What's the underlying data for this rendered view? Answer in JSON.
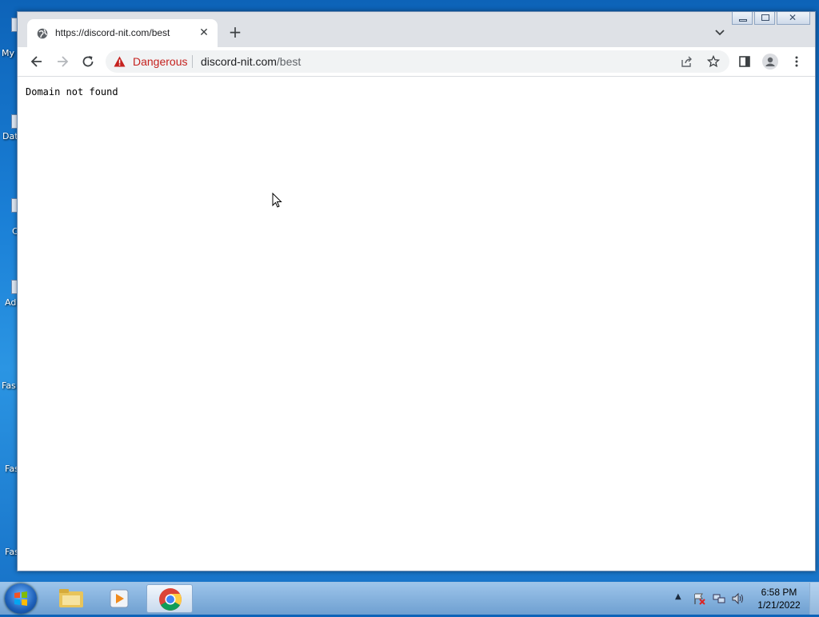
{
  "desktop": {
    "icons": [
      {
        "label": "My"
      },
      {
        "label": "Dat"
      },
      {
        "label": "C"
      },
      {
        "label": "Ad"
      },
      {
        "label": "Fas"
      },
      {
        "label": "Fas"
      },
      {
        "label": "Fas"
      }
    ]
  },
  "browser": {
    "tab": {
      "title": "https://discord-nit.com/best",
      "favicon": "globe-icon"
    },
    "omnibox": {
      "security_label": "Dangerous",
      "domain": "discord-nit.com",
      "path": "/best"
    },
    "page": {
      "text": "Domain not found"
    }
  },
  "taskbar": {
    "apps": [
      "windows-explorer",
      "media-player",
      "chrome"
    ],
    "clock": {
      "time": "6:58 PM",
      "date": "1/21/2022"
    }
  },
  "colors": {
    "danger": "#c5221f",
    "tabstrip": "#dee1e6",
    "omnibox": "#f1f3f4"
  }
}
